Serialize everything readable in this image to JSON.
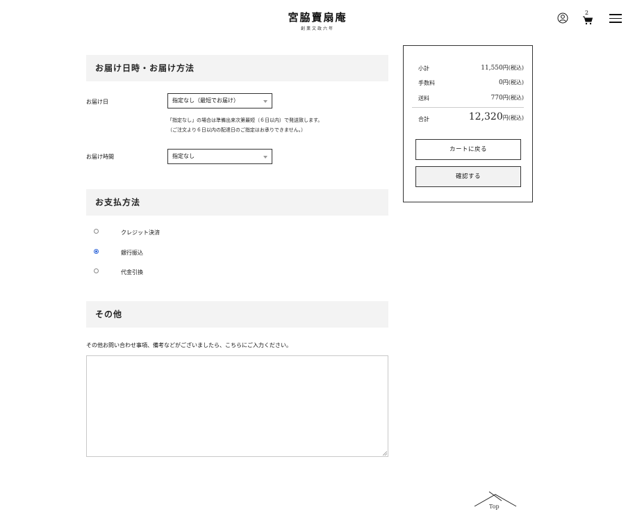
{
  "header": {
    "logo_main": "宮脇賣扇庵",
    "logo_sub": "創業文政六年",
    "cart_count": "2"
  },
  "delivery": {
    "title": "お届け日時・お届け方法",
    "date_label": "お届け日",
    "date_value": "指定なし（最短でお届け）",
    "note_line1": "「指定なし」の場合は準備出来次第最短（６日以内）で発送致します。",
    "note_line2": "（ご注文より６日以内の配達日のご指定はお承りできません。）",
    "time_label": "お届け時間",
    "time_value": "指定なし"
  },
  "payment": {
    "title": "お支払方法",
    "options": [
      {
        "label": "クレジット決済",
        "checked": false
      },
      {
        "label": "銀行振込",
        "checked": true
      },
      {
        "label": "代金引換",
        "checked": false
      }
    ]
  },
  "other": {
    "title": "その他",
    "prompt": "その他お問い合わせ事項、備考などがございましたら、こちらにご入力ください。",
    "value": ""
  },
  "summary": {
    "subtotal_label": "小計",
    "subtotal_value": "11,550",
    "fee_label": "手数料",
    "fee_value": "0",
    "shipping_label": "送料",
    "shipping_value": "770",
    "total_label": "合計",
    "total_value": "12,320",
    "currency_suffix": "円(税込)",
    "back_button": "カートに戻る",
    "confirm_button": "確認する"
  },
  "footer": {
    "top_label": "Top"
  }
}
